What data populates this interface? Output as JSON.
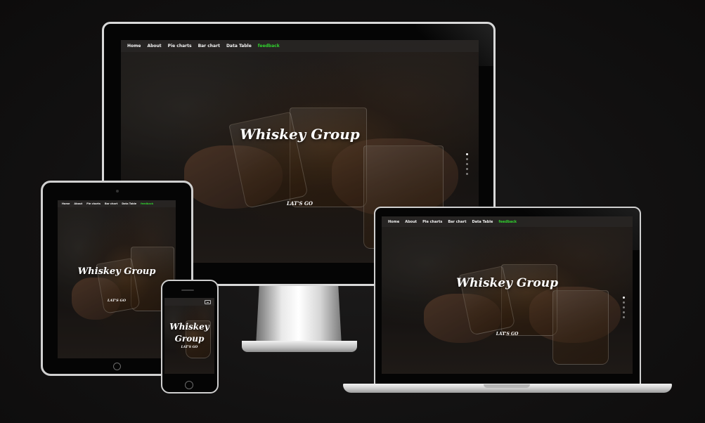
{
  "site": {
    "nav": [
      "Home",
      "About",
      "Pie charts",
      "Bar chart",
      "Data Table"
    ],
    "nav_accent": "feedback",
    "title": "Whiskey Group",
    "cta": "LAT'S GO"
  },
  "mobile": {
    "title_line1": "Whiskey",
    "title_line2": "Group",
    "cta": "LAT'S GO"
  },
  "colors": {
    "accent": "#31d12e",
    "background": "#121111",
    "device_frame": "#d9d9d9"
  },
  "icons": [
    "hamburger-menu-icon",
    "carousel-indicator-dots"
  ]
}
